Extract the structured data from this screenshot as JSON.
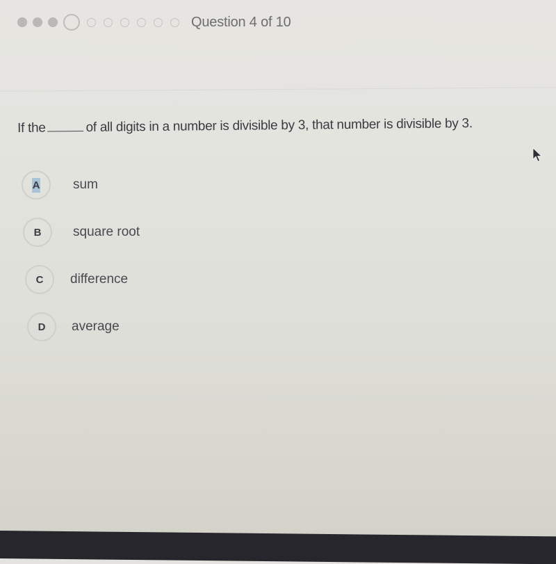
{
  "progress": {
    "total_questions": 10,
    "current_question": 4,
    "completed": 3,
    "counter_text": "Question 4 of 10"
  },
  "question": {
    "prefix": "If the",
    "suffix": "of all digits in a number is divisible by 3, that number is divisible by 3."
  },
  "choices": [
    {
      "letter": "A",
      "text": "sum",
      "highlighted": true
    },
    {
      "letter": "B",
      "text": "square root",
      "highlighted": false
    },
    {
      "letter": "C",
      "text": "difference",
      "highlighted": false
    },
    {
      "letter": "D",
      "text": "average",
      "highlighted": false
    }
  ],
  "icons": {
    "cursor": "mouse-pointer-icon"
  },
  "colors": {
    "text": "#3b3a40",
    "muted": "#6e6d70",
    "dot_done": "#b9b8b6",
    "bubble_border": "#cfcfcb",
    "highlight": "#a9c3d7",
    "bezel": "#26262c"
  }
}
